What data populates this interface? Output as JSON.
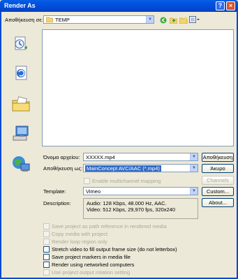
{
  "window": {
    "title": "Render As",
    "help": "?",
    "close": "×"
  },
  "save_in": {
    "label": "Αποθήκευση σε:",
    "value": "TEMP"
  },
  "filename": {
    "label": "Όνομα αρχείου:",
    "value": "XXXXX.mp4"
  },
  "save_as_type": {
    "label": "Αποθήκευση ως:",
    "value": "MainConcept AVC/AAC (*.mp4)"
  },
  "buttons": {
    "save": "Αποθήκευση",
    "cancel": "Άκυρο",
    "channels": "Channels",
    "custom": "Custom...",
    "about": "About..."
  },
  "multichannel": "Enable multichannel mapping",
  "template": {
    "label": "Template:",
    "value": "Vimeo"
  },
  "description": {
    "label": "Description:",
    "line1": "Audio: 128 Kbps, 48.000 Hz, AAC.",
    "line2": "Video: 512 Kbps, 29,970 fps, 320x240"
  },
  "options": [
    {
      "label": "Save project as path reference in rendered media",
      "enabled": false
    },
    {
      "label": "Copy media with project",
      "enabled": false
    },
    {
      "label": "Render loop region only",
      "enabled": false
    },
    {
      "label": "Stretch video to fill output frame size (do not letterbox)",
      "enabled": true
    },
    {
      "label": "Save project markers in media file",
      "enabled": true
    },
    {
      "label": "Render using networked computers",
      "enabled": true
    },
    {
      "label": "Use project output rotation setting",
      "enabled": false
    }
  ],
  "icons": {
    "places": [
      "recent-documents-icon",
      "desktop-icon",
      "my-documents-icon",
      "my-computer-icon",
      "network-places-icon"
    ],
    "toolbar": [
      "back-icon",
      "up-folder-icon",
      "new-folder-icon",
      "view-menu-icon"
    ]
  },
  "colors": {
    "titlebar": "#0053e1",
    "dialog": "#ece9d8",
    "selection": "#316ac5"
  }
}
